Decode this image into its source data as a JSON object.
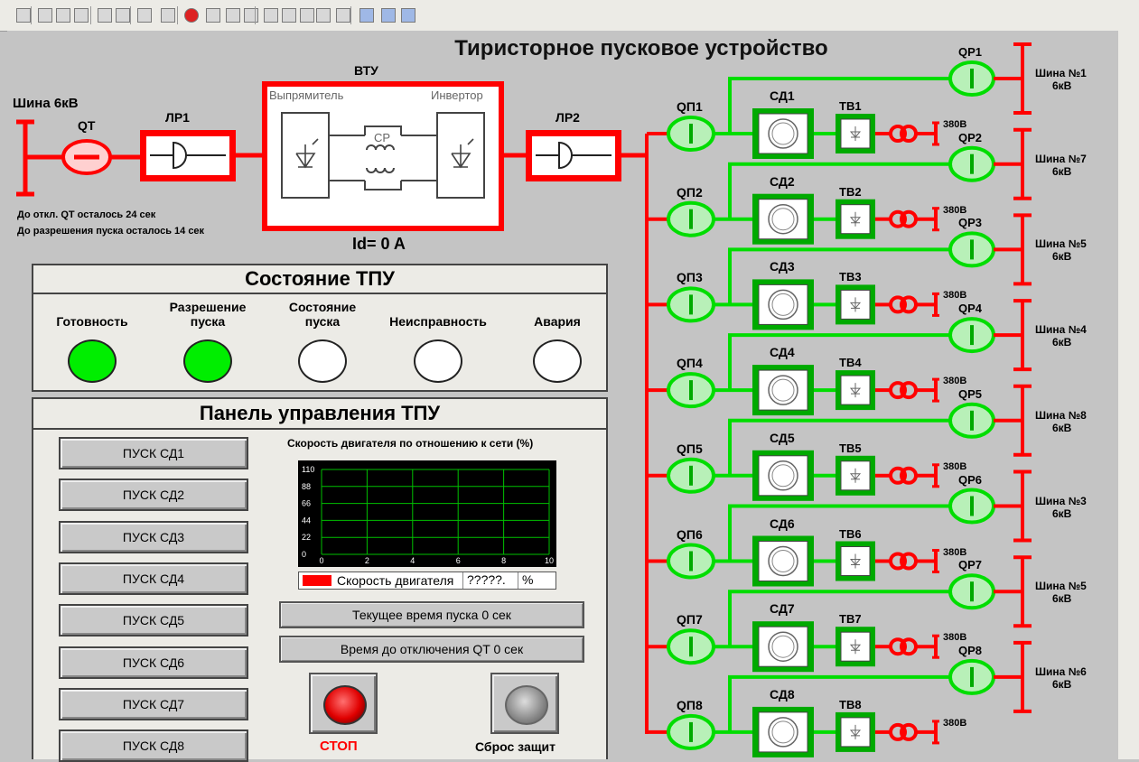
{
  "title": "Тиристорное пусковое устройство",
  "left_bus": {
    "label": "Шина 6кВ"
  },
  "qt": {
    "label": "QT"
  },
  "lr1": {
    "label": "ЛР1"
  },
  "lr2": {
    "label": "ЛР2"
  },
  "vtu": {
    "label": "ВТУ",
    "rectifier": "Выпрямитель",
    "inverter": "Инвертор",
    "cp": "СР"
  },
  "id_readout": "Id=  0 A",
  "timers": {
    "qt_off": "До откл. QT осталось  24 сек",
    "start_permit": "До разрешения пуска осталось  14 сек"
  },
  "status_panel": {
    "title": "Состояние ТПУ",
    "indicators": [
      {
        "label": "Готовность",
        "color": "#00ee00"
      },
      {
        "label": "Разрешение\nпуска",
        "color": "#00ee00"
      },
      {
        "label": "Состояние\nпуска",
        "color": "#ffffff"
      },
      {
        "label": "Неисправность",
        "color": "#ffffff"
      },
      {
        "label": "Авария",
        "color": "#ffffff"
      }
    ]
  },
  "control_panel": {
    "title": "Панель управления ТПУ",
    "start_buttons": [
      "ПУСК СД1",
      "ПУСК СД2",
      "ПУСК СД3",
      "ПУСК СД4",
      "ПУСК СД5",
      "ПУСК СД6",
      "ПУСК СД7",
      "ПУСК СД8"
    ],
    "chart_title": "Скорость двигателя по отношению к сети (%)",
    "legend_name": "Скорость двигателя",
    "legend_value": "?????.",
    "legend_unit": "%",
    "current_time": "Текущее время пуска  0 сек",
    "qt_time": "Время до отключения QT  0 сек",
    "stop_label": "СТОП",
    "reset_label": "Сброс защит"
  },
  "chart_data": {
    "type": "line",
    "title": "Скорость двигателя по отношению к сети (%)",
    "x_ticks": [
      "0",
      "2",
      "4",
      "6",
      "8",
      "10"
    ],
    "y_ticks": [
      "0",
      "22",
      "44",
      "66",
      "88",
      "110"
    ],
    "xlim": [
      0,
      10
    ],
    "ylim": [
      0,
      110
    ],
    "grid": true,
    "series": [
      {
        "name": "Скорость двигателя",
        "values": []
      }
    ]
  },
  "branches": [
    {
      "qp_in": "QП1",
      "sd": "СД1",
      "tv": "ТВ1",
      "v": "380В",
      "qp_out": "QP1",
      "bus": "Шина №1",
      "kv": "6кВ"
    },
    {
      "qp_in": "QП2",
      "sd": "СД2",
      "tv": "ТВ2",
      "v": "380В",
      "qp_out": "QP2",
      "bus": "Шина №7",
      "kv": "6кВ"
    },
    {
      "qp_in": "QП3",
      "sd": "СД3",
      "tv": "ТВ3",
      "v": "380В",
      "qp_out": "QP3",
      "bus": "Шина №5",
      "kv": "6кВ"
    },
    {
      "qp_in": "QП4",
      "sd": "СД4",
      "tv": "ТВ4",
      "v": "380В",
      "qp_out": "QP4",
      "bus": "Шина №4",
      "kv": "6кВ"
    },
    {
      "qp_in": "QП5",
      "sd": "СД5",
      "tv": "ТВ5",
      "v": "380В",
      "qp_out": "QP5",
      "bus": "Шина №8",
      "kv": "6кВ"
    },
    {
      "qp_in": "QП6",
      "sd": "СД6",
      "tv": "ТВ6",
      "v": "380В",
      "qp_out": "QP6",
      "bus": "Шина №3",
      "kv": "6кВ"
    },
    {
      "qp_in": "QП7",
      "sd": "СД7",
      "tv": "ТВ7",
      "v": "380В",
      "qp_out": "QP7",
      "bus": "Шина №5",
      "kv": "6кВ"
    },
    {
      "qp_in": "QП8",
      "sd": "СД8",
      "tv": "ТВ8",
      "v": "380В",
      "qp_out": "QP8",
      "bus": "Шина №6",
      "kv": "6кВ"
    }
  ],
  "colors": {
    "energized": "#ff0000",
    "active": "#00dd00",
    "breaker_fill": "#b8f0b8",
    "qt_fill": "#ffd0d0"
  },
  "toolbar": {
    "icons": [
      "app-icon",
      "window-icon",
      "tree-icon",
      "bars-icon",
      "home-icon",
      "back-list-icon",
      "back-icon",
      "forward-icon",
      "stop-icon",
      "print-icon",
      "font-icon",
      "binoculars-icon",
      "table-icon",
      "report-icon",
      "properties-icon",
      "frame-icon",
      "rectangle-icon",
      "view1-icon",
      "view2-icon",
      "view3-icon"
    ]
  }
}
